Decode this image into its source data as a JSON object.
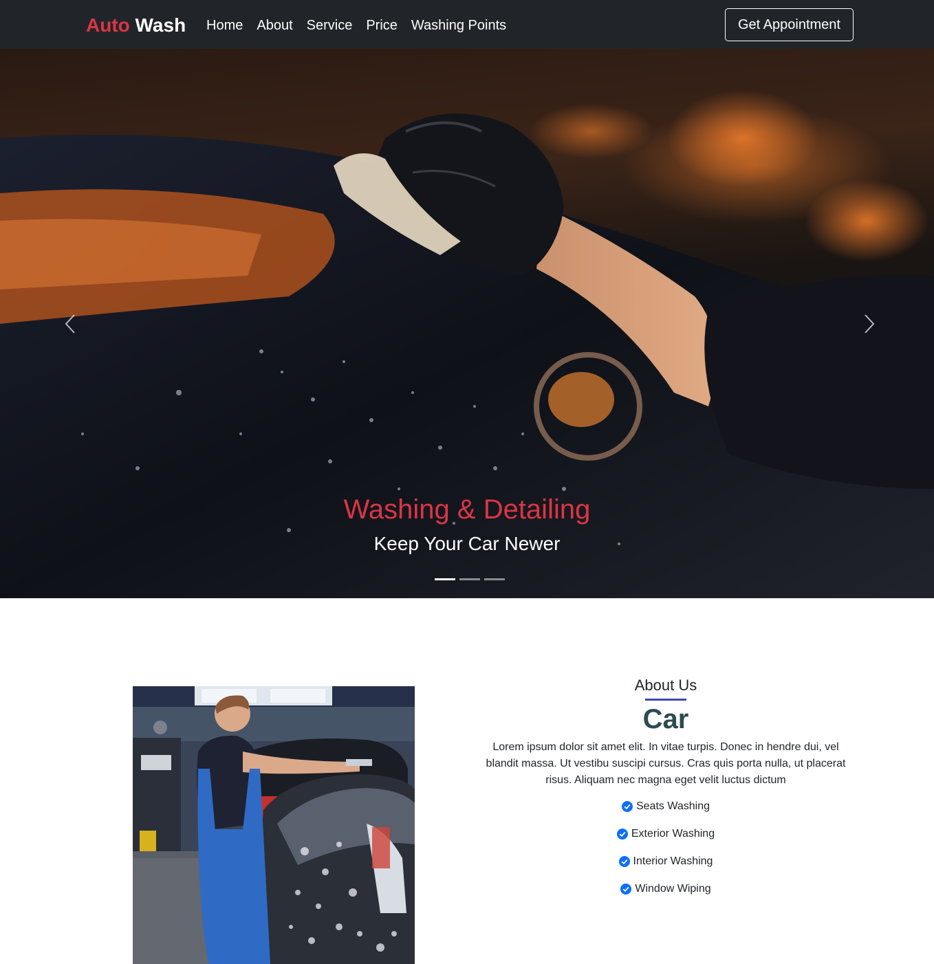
{
  "navbar": {
    "brand_part1": "Auto",
    "brand_part2": "Wash",
    "links": [
      "Home",
      "About",
      "Service",
      "Price",
      "Washing Points"
    ],
    "appointment_button": "Get Appointment"
  },
  "hero": {
    "title": "Washing & Detailing",
    "subtitle": "Keep Your Car Newer",
    "slide_count": 3,
    "active_slide": 1,
    "prev_icon": "chevron-left-icon",
    "next_icon": "chevron-right-icon"
  },
  "about": {
    "heading": "About Us",
    "title": "Car",
    "description": "Lorem ipsum dolor sit amet elit. In vitae turpis. Donec in hendre dui, vel blandit massa. Ut vestibu suscipi cursus. Cras quis porta nulla, ut placerat risus. Aliquam nec magna eget velit luctus dictum",
    "features": [
      "Seats Washing",
      "Exterior Washing",
      "Interior Washing",
      "Window Wiping"
    ],
    "feature_icon": "check-circle-icon"
  },
  "colors": {
    "navbar_bg": "#212529",
    "brand_red": "#dc3545",
    "accent_line": "#4046b8",
    "title_color": "#2d4a52",
    "check_blue": "#0d6efd"
  }
}
